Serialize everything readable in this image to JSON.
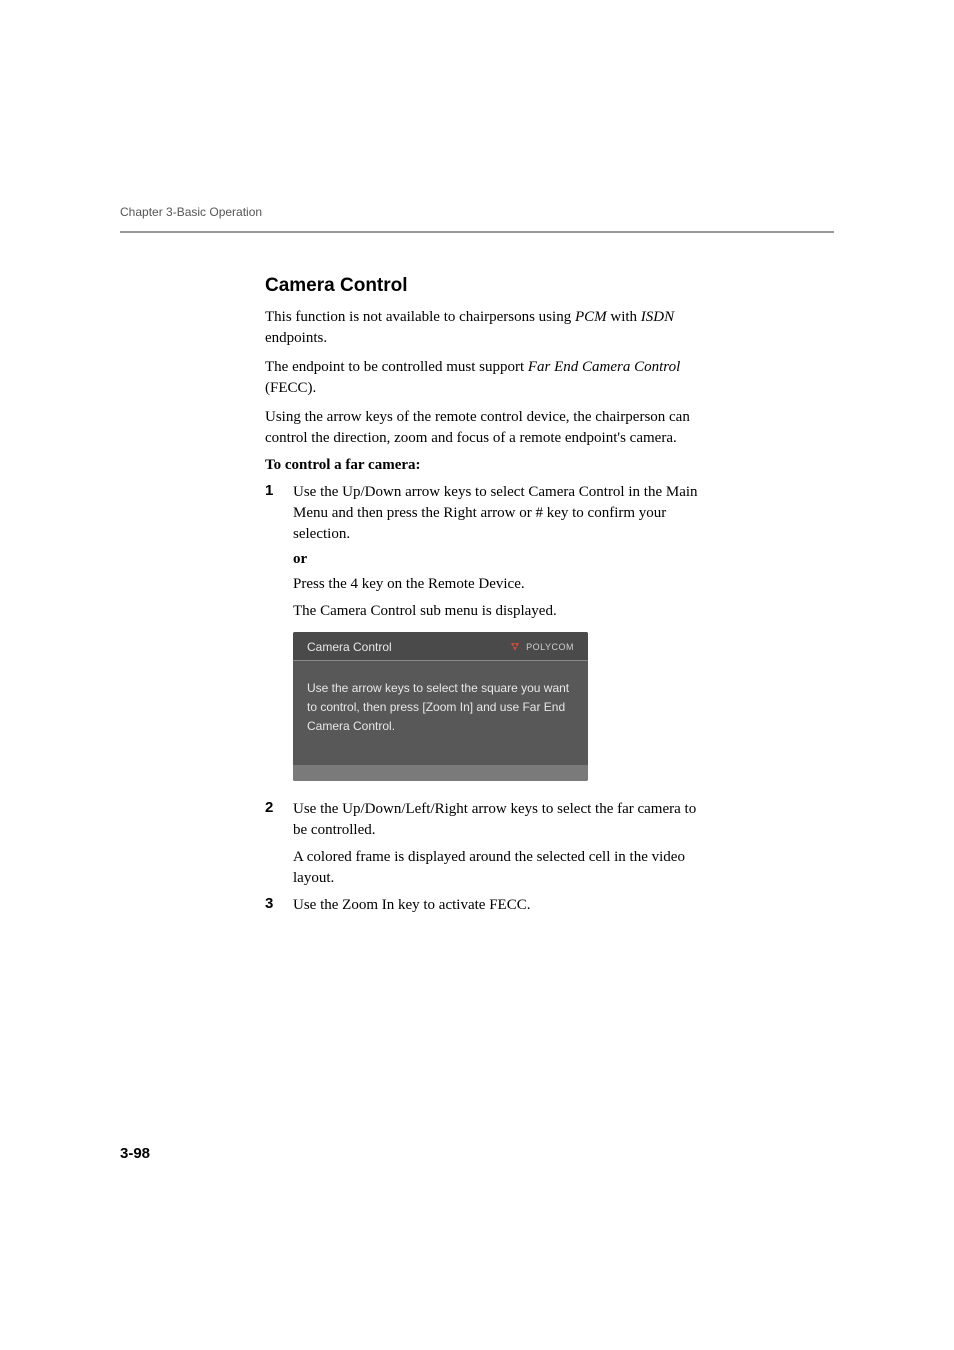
{
  "chapter_header": "Chapter 3-Basic Operation",
  "section": {
    "heading": "Camera Control",
    "para1_pre": "This function is not available to chairpersons using ",
    "para1_i1": "PCM",
    "para1_mid": " with ",
    "para1_i2": "ISDN",
    "para1_post": " endpoints.",
    "para2_pre": "The endpoint to be controlled must support ",
    "para2_i1": "Far End Camera Control",
    "para2_post": " (FECC).",
    "para3": "Using the arrow keys of the remote control device, the chairperson can control the direction, zoom and focus of a remote endpoint's camera.",
    "procedure_title": "To control a far camera:",
    "step1_num": "1",
    "step1_a_pre": "Use the ",
    "step1_a_b1": "Up/Down",
    "step1_a_mid1": " arrow keys to select ",
    "step1_a_b2": "Camera Control",
    "step1_a_mid2": " in the ",
    "step1_a_i1": "Main Menu",
    "step1_a_mid3": " and then press the ",
    "step1_a_b3": "Right",
    "step1_a_mid4": " arrow or ",
    "step1_a_b4": "#",
    "step1_a_post": " key to confirm your selection.",
    "step1_or": "or",
    "step1_b_pre": "Press the ",
    "step1_b_b1": "4",
    "step1_b_mid": " key on the ",
    "step1_b_i1": "Remote Device",
    "step1_b_post": ".",
    "step1_c_pre": "The ",
    "step1_c_i1": "Camera Control",
    "step1_c_post": " sub menu is displayed.",
    "step2_num": "2",
    "step2_a_pre": "Use the ",
    "step2_a_b1": "Up/Down/Left/Right",
    "step2_a_post": " arrow keys to select the far camera to be controlled.",
    "step2_b": "A colored frame is displayed around the selected cell in the video layout.",
    "step3_num": "3",
    "step3_pre": "Use the ",
    "step3_b1": "Zoom In",
    "step3_mid": " key to activate ",
    "step3_i1": "FECC",
    "step3_post": "."
  },
  "screenshot": {
    "title": "Camera Control",
    "logo_text": "POLYCOM",
    "instructions": "Use the arrow keys to select the square you want to control, then press [Zoom In] and use Far End Camera Control."
  },
  "page_number": "3-98"
}
